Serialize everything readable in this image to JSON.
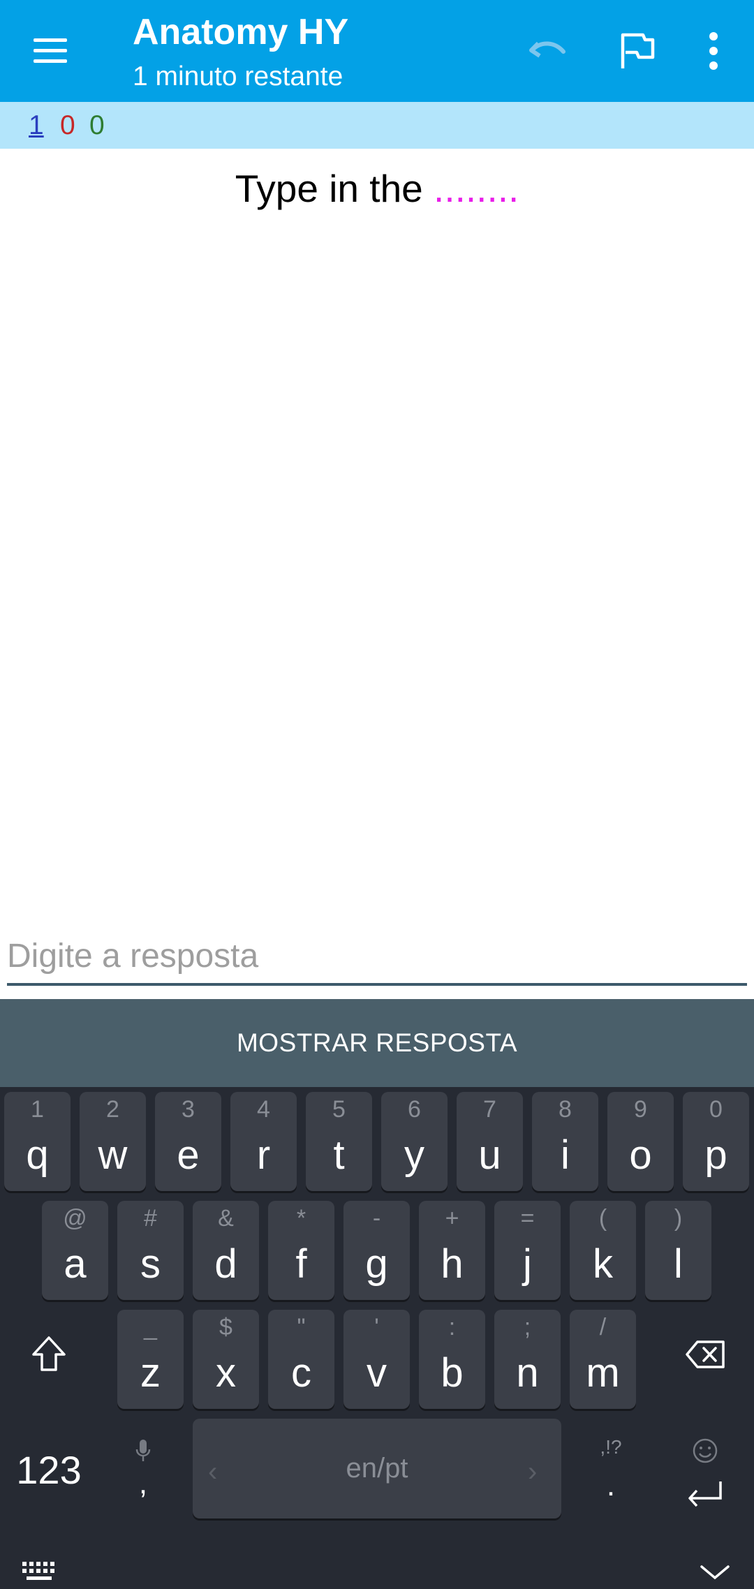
{
  "appbar": {
    "title": "Anatomy HY",
    "subtitle": "1 minuto restante",
    "icons": [
      "menu-icon",
      "undo-icon",
      "flag-icon",
      "more-vert-icon"
    ],
    "color": "#03a1e6"
  },
  "counts": {
    "new": "1",
    "learning": "0",
    "review": "0"
  },
  "card": {
    "question_text": "Type in the ",
    "cloze": "........"
  },
  "answer": {
    "placeholder": "Digite a resposta",
    "value": ""
  },
  "show_answer_label": "MOSTRAR RESPOSTA",
  "keyboard": {
    "row1": [
      {
        "main": "q",
        "hint": "1"
      },
      {
        "main": "w",
        "hint": "2"
      },
      {
        "main": "e",
        "hint": "3"
      },
      {
        "main": "r",
        "hint": "4"
      },
      {
        "main": "t",
        "hint": "5"
      },
      {
        "main": "y",
        "hint": "6"
      },
      {
        "main": "u",
        "hint": "7"
      },
      {
        "main": "i",
        "hint": "8"
      },
      {
        "main": "o",
        "hint": "9"
      },
      {
        "main": "p",
        "hint": "0"
      }
    ],
    "row2": [
      {
        "main": "a",
        "hint": "@"
      },
      {
        "main": "s",
        "hint": "#"
      },
      {
        "main": "d",
        "hint": "&"
      },
      {
        "main": "f",
        "hint": "*"
      },
      {
        "main": "g",
        "hint": "-"
      },
      {
        "main": "h",
        "hint": "+"
      },
      {
        "main": "j",
        "hint": "="
      },
      {
        "main": "k",
        "hint": "("
      },
      {
        "main": "l",
        "hint": ")"
      }
    ],
    "row3": [
      {
        "main": "z",
        "hint": "_"
      },
      {
        "main": "x",
        "hint": "$"
      },
      {
        "main": "c",
        "hint": "\""
      },
      {
        "main": "v",
        "hint": "'"
      },
      {
        "main": "b",
        "hint": ":"
      },
      {
        "main": "n",
        "hint": ";"
      },
      {
        "main": "m",
        "hint": "/"
      }
    ],
    "numbers_label": "123",
    "comma": ",",
    "space_label": "en/pt",
    "period": ".",
    "punct_hint": ",!?"
  }
}
